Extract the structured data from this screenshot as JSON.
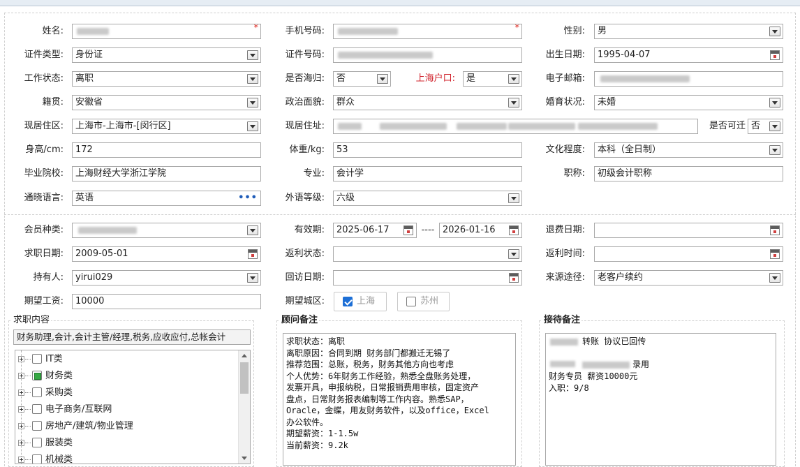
{
  "colors": {
    "required": "#e0281f",
    "accent": "#1d6fd6",
    "label_red": "#d0202a",
    "tree_partial": "#35a843"
  },
  "personal": {
    "name_label": "姓名:",
    "phone_label": "手机号码:",
    "gender_label": "性别:",
    "gender": "男",
    "id_type_label": "证件类型:",
    "id_type": "身份证",
    "id_no_label": "证件号码:",
    "birth_label": "出生日期:",
    "birth": "1995-04-07",
    "work_status_label": "工作状态:",
    "work_status": "离职",
    "overseas_label": "是否海归:",
    "overseas": "否",
    "hukou_label": "上海户口:",
    "hukou": "是",
    "email_label": "电子邮箱:",
    "native_label": "籍贯:",
    "native": "安徽省",
    "political_label": "政治面貌:",
    "political": "群众",
    "marital_label": "婚育状况:",
    "marital": "未婚",
    "district_label": "现居住区:",
    "district": "上海市-上海市-[闵行区]",
    "address_label": "现居住址:",
    "relocate_label": "是否可迁",
    "relocate": "否",
    "height_label": "身高/cm:",
    "height": "172",
    "weight_label": "体重/kg:",
    "weight": "53",
    "education_label": "文化程度:",
    "education": "本科（全日制）",
    "school_label": "毕业院校:",
    "school": "上海财经大学浙江学院",
    "major_label": "专业:",
    "major": "会计学",
    "title_label": "职称:",
    "title": "初级会计职称",
    "language_label": "通晓语言:",
    "language": "英语",
    "lang_level_label": "外语等级:",
    "lang_level": "六级"
  },
  "membership": {
    "member_type_label": "会员种类:",
    "valid_label": "有效期:",
    "valid_from": "2025-06-17",
    "valid_sep": "----",
    "valid_to": "2026-01-16",
    "refund_date_label": "退费日期:",
    "apply_date_label": "求职日期:",
    "apply_date": "2009-05-01",
    "rebate_status_label": "返利状态:",
    "rebate_time_label": "返利时间:",
    "holder_label": "持有人:",
    "holder": "yirui029",
    "revisit_label": "回访日期:",
    "source_label": "来源途径:",
    "source": "老客户续约",
    "salary_label": "期望工资:",
    "salary": "10000",
    "city_label": "期望城区:",
    "cities": [
      {
        "label": "上海",
        "checked": true
      },
      {
        "label": "苏州",
        "checked": false
      }
    ]
  },
  "job_panel": {
    "title": "求职内容",
    "summary": "财务助理,会计,会计主管/经理,税务,应收应付,总帐会计",
    "tree": [
      {
        "label": "IT类",
        "state": "none"
      },
      {
        "label": "财务类",
        "state": "partial"
      },
      {
        "label": "采购类",
        "state": "none"
      },
      {
        "label": "电子商务/互联网",
        "state": "none"
      },
      {
        "label": "房地产/建筑/物业管理",
        "state": "none"
      },
      {
        "label": "服装类",
        "state": "none"
      },
      {
        "label": "机械类",
        "state": "none"
      }
    ]
  },
  "advisor_panel": {
    "title": "顾问备注",
    "lines": [
      "求职状态：离职",
      "离职原因：合同到期 财务部门都搬迁无锡了",
      "推荐范围：总账，税务，财务其他方向也考虑",
      "个人优势：6年财务工作经验，熟悉全盘账务处理，",
      "发票开具，申报纳税，日常报销费用审核，固定资产",
      "盘点，日常财务报表编制等工作内容。熟悉SAP，",
      "Oracle，金蝶，用友财务软件，以及office，Excel",
      "办公软件。",
      "期望薪资：1-1.5w",
      "当前薪资：9.2k"
    ]
  },
  "reception_panel": {
    "title": "接待备注",
    "line1": "转账 协议已回传",
    "line2_suffix": "录用",
    "line3": "财务专员 薪资10000元",
    "line4": "入职：9/8"
  }
}
